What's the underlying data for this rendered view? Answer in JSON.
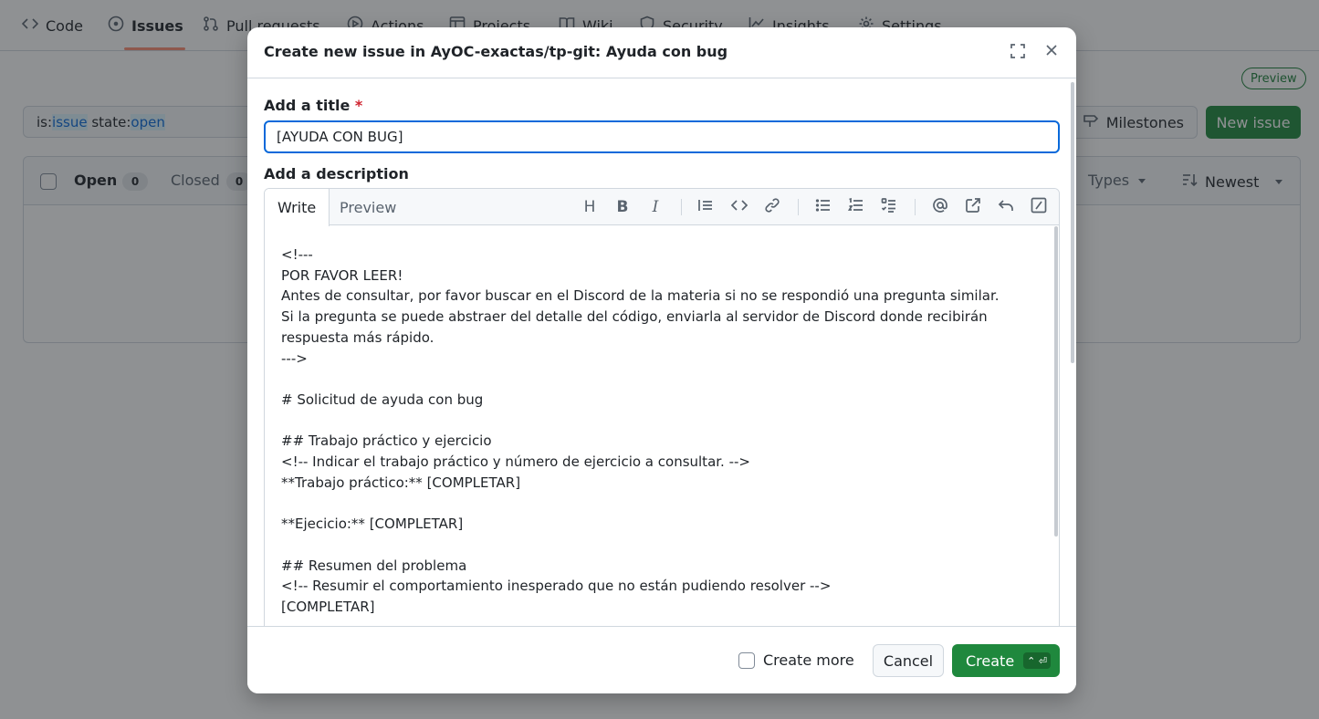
{
  "repo_nav": {
    "tabs": [
      {
        "label": "Code",
        "icon": "code-icon"
      },
      {
        "label": "Issues",
        "icon": "issue-opened-icon",
        "active": true
      },
      {
        "label": "Pull requests",
        "icon": "git-pull-request-icon"
      },
      {
        "label": "Actions",
        "icon": "play-icon"
      },
      {
        "label": "Projects",
        "icon": "table-icon"
      },
      {
        "label": "Wiki",
        "icon": "book-icon"
      },
      {
        "label": "Security",
        "icon": "shield-icon"
      },
      {
        "label": "Insights",
        "icon": "graph-icon"
      },
      {
        "label": "Settings",
        "icon": "gear-icon"
      }
    ]
  },
  "page": {
    "preview_badge": "Preview",
    "search": {
      "prefix1": "is:",
      "value1": "issue",
      "prefix2": " state:",
      "value2": "open"
    },
    "milestones_label": "Milestones",
    "new_issue_label": "New issue",
    "list_header": {
      "open_label": "Open",
      "open_count": "0",
      "closed_label": "Closed",
      "closed_count": "0",
      "types_label": "Types",
      "sort_label": "Newest"
    }
  },
  "dialog": {
    "title": "Create new issue in AyOC-exactas/tp-git: Ayuda con bug",
    "title_field": {
      "label": "Add a title",
      "required_mark": "*",
      "value": "[AYUDA CON BUG]"
    },
    "description": {
      "label": "Add a description",
      "tabs": [
        "Write",
        "Preview"
      ],
      "toolbar": [
        "heading-icon",
        "bold-icon",
        "italic-icon",
        "quote-icon",
        "code-icon",
        "link-icon",
        "bulleted-list-icon",
        "numbered-list-icon",
        "task-list-icon",
        "mention-icon",
        "cross-reference-icon",
        "reply-icon",
        "slash-command-icon"
      ],
      "text": "<!---\nPOR FAVOR LEER!\nAntes de consultar, por favor buscar en el Discord de la materia si no se respondió una pregunta similar.\nSi la pregunta se puede abstraer del detalle del código, enviarla al servidor de Discord donde recibirán\nrespuesta más rápido.\n--->\n\n# Solicitud de ayuda con bug\n\n## Trabajo práctico y ejercicio\n<!-- Indicar el trabajo práctico y número de ejercicio a consultar. -->\n**Trabajo práctico:** [COMPLETAR]\n\n**Ejecicio:** [COMPLETAR]\n\n## Resumen del problema\n<!-- Resumir el comportamiento inesperado que no están pudiendo resolver -->\n[COMPLETAR]"
    },
    "footer": {
      "create_more_label": "Create more",
      "cancel_label": "Cancel",
      "create_label": "Create",
      "create_shortcut": "⌃ ⏎"
    }
  }
}
